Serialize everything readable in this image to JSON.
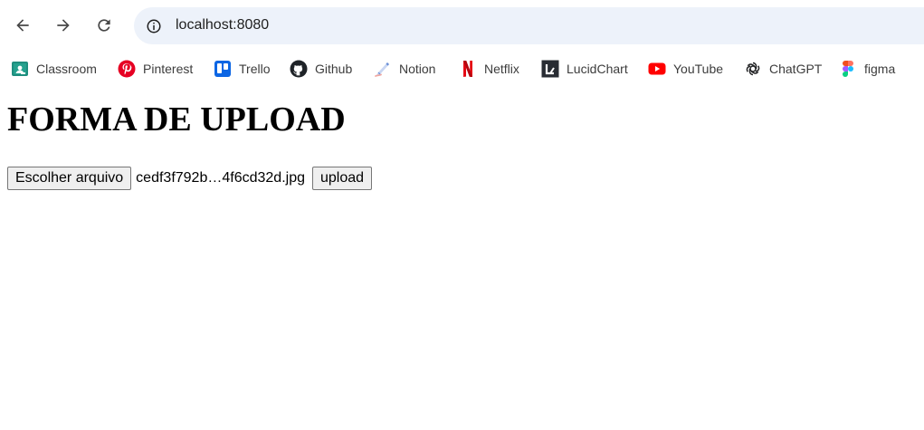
{
  "browser": {
    "url": "localhost:8080"
  },
  "bookmarks": [
    {
      "label": "Classroom",
      "icon": "classroom-icon",
      "color": "#1e8e7e"
    },
    {
      "label": "Pinterest",
      "icon": "pinterest-icon",
      "color": "#e60023"
    },
    {
      "label": "Trello",
      "icon": "trello-icon",
      "color": "#0c66e4"
    },
    {
      "label": "Github",
      "icon": "github-icon",
      "color": "#1f2328"
    },
    {
      "label": "Notion",
      "icon": "notion-icon",
      "color": "#6b8fd6"
    },
    {
      "label": "Netflix",
      "icon": "netflix-icon",
      "color": "#e50914"
    },
    {
      "label": "LucidChart",
      "icon": "lucidchart-icon",
      "color": "#282c33"
    },
    {
      "label": "YouTube",
      "icon": "youtube-icon",
      "color": "#ff0000"
    },
    {
      "label": "ChatGPT",
      "icon": "chatgpt-icon",
      "color": "#202123"
    },
    {
      "label": "figma",
      "icon": "figma-icon",
      "color": "#a259ff"
    }
  ],
  "page": {
    "title": "FORMA DE UPLOAD",
    "choose_file_label": "Escolher arquivo",
    "file_name": "cedf3f792b…4f6cd32d.jpg",
    "upload_label": "upload"
  }
}
